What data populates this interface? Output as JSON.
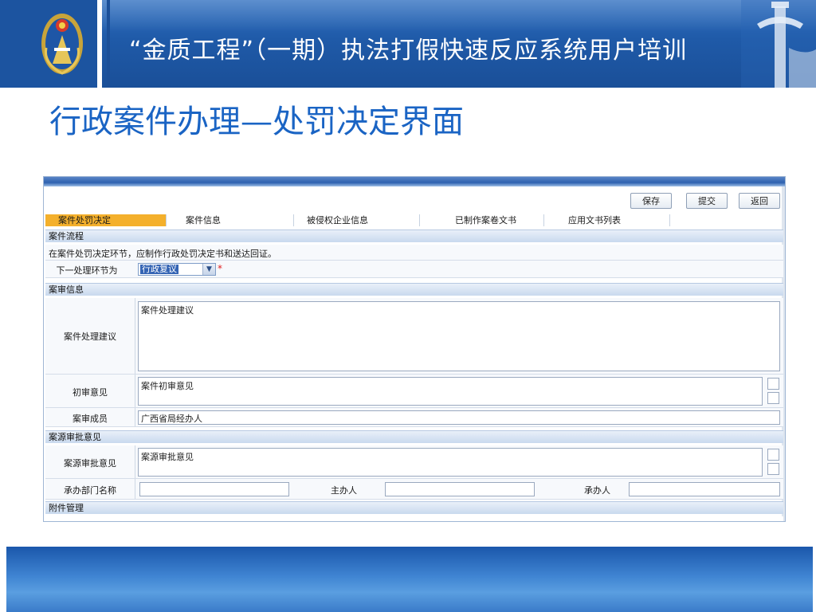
{
  "header": {
    "title": "“金质工程”（一期）执法打假快速反应系统用户培训"
  },
  "slide_title": "行政案件办理—处罚决定界面",
  "app": {
    "toolbar": {
      "save": "保存",
      "submit": "提交",
      "back": "返回"
    },
    "tabs": [
      {
        "label": "案件处罚决定",
        "active": true
      },
      {
        "label": "案件信息",
        "active": false
      },
      {
        "label": "被侵权企业信息",
        "active": false
      },
      {
        "label": "已制作案卷文书",
        "active": false
      },
      {
        "label": "应用文书列表",
        "active": false
      }
    ],
    "sections": {
      "flow": "案件流程",
      "review": "案审信息",
      "source_approval": "案源审批意见",
      "attachments": "附件管理"
    },
    "flow": {
      "notice": "在案件处罚决定环节，应制作行政处罚决定书和送达回证。",
      "next_step_label": "下一处理环节为",
      "next_step_value": "行政复议"
    },
    "review": {
      "suggestion_label": "案件处理建议",
      "suggestion_value": "案件处理建议",
      "first_opinion_label": "初审意见",
      "first_opinion_value": "案件初审意见",
      "members_label": "案审成员",
      "members_value": "广西省局经办人"
    },
    "source": {
      "approval_label": "案源审批意见",
      "approval_value": "案源审批意见",
      "dept_label": "承办部门名称",
      "dept_value": "",
      "host_label": "主办人",
      "host_value": "",
      "handler_label": "承办人",
      "handler_value": ""
    }
  },
  "colors": {
    "header_blue": "#1f5aa8",
    "title_blue": "#1a64c4",
    "active_tab": "#f4b02c",
    "selection": "#3464b4",
    "required": "#e02020"
  }
}
